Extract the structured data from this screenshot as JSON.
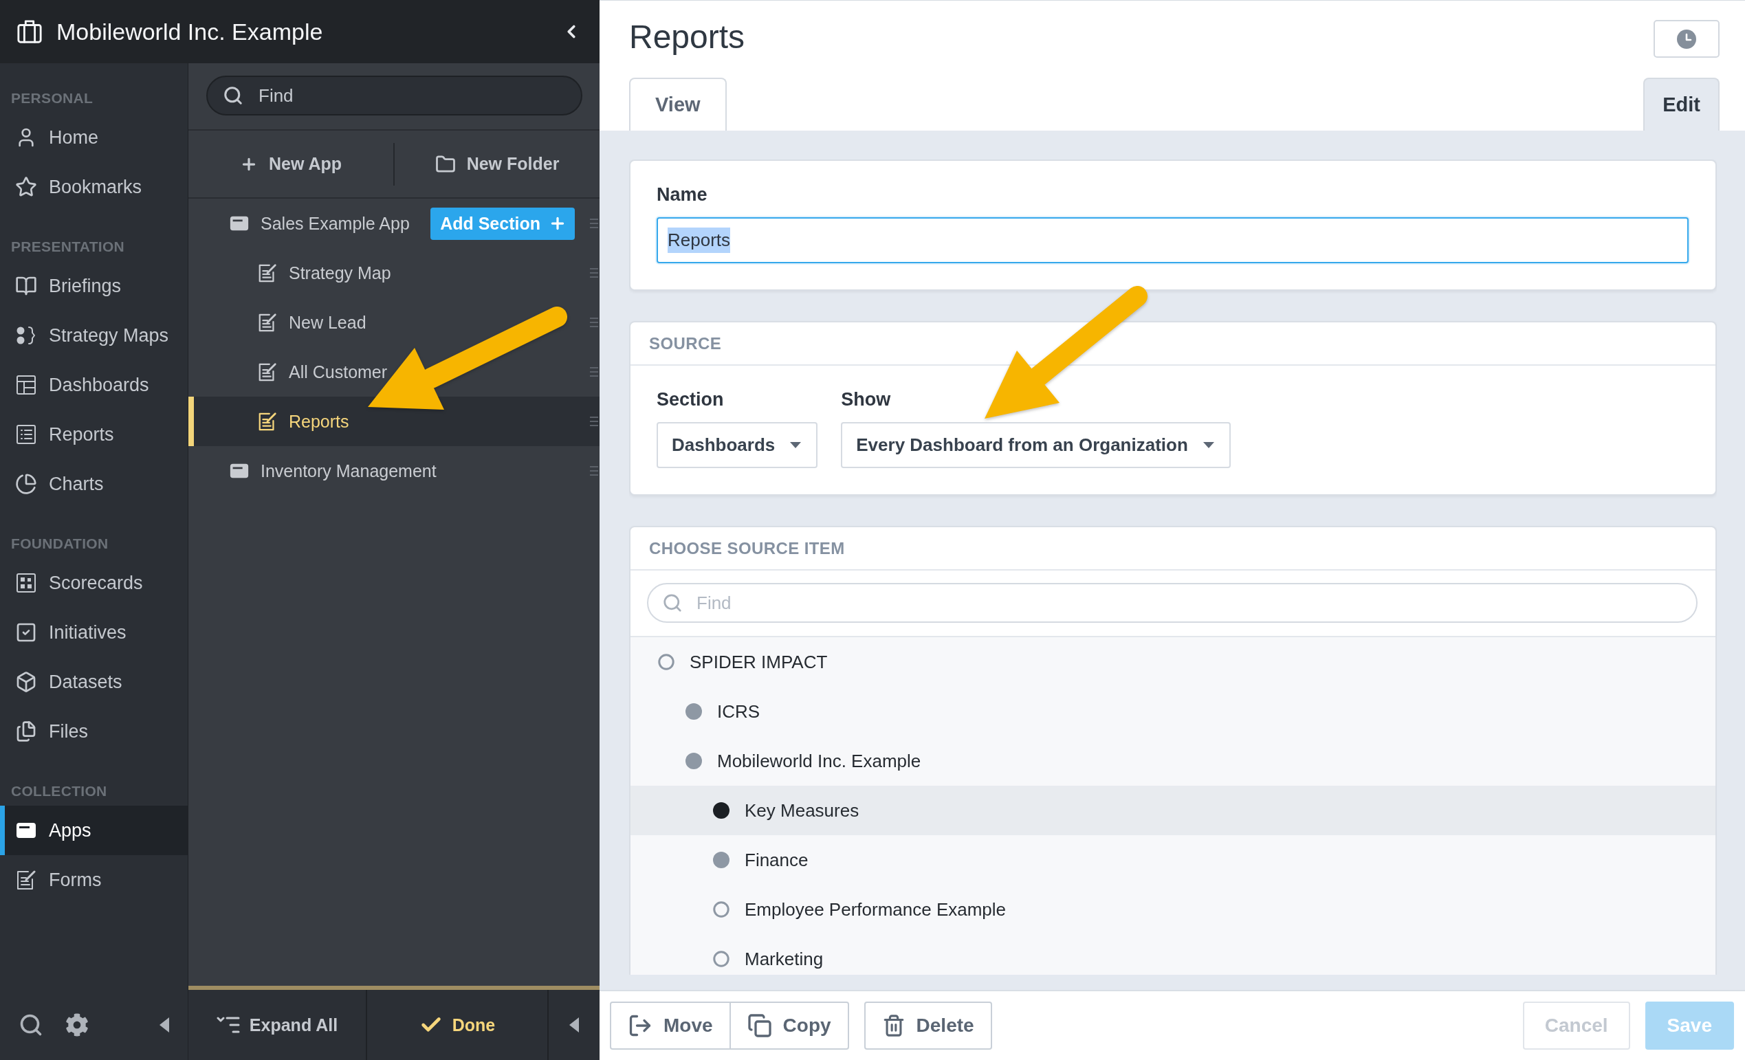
{
  "header": {
    "title": "Mobileworld Inc. Example"
  },
  "nav": [
    {
      "heading": "PERSONAL",
      "items": [
        {
          "label": "Home",
          "selected": false
        },
        {
          "label": "Bookmarks",
          "selected": false
        }
      ]
    },
    {
      "heading": "PRESENTATION",
      "items": [
        {
          "label": "Briefings",
          "selected": false
        },
        {
          "label": "Strategy Maps",
          "selected": false
        },
        {
          "label": "Dashboards",
          "selected": false
        },
        {
          "label": "Reports",
          "selected": false
        },
        {
          "label": "Charts",
          "selected": false
        }
      ]
    },
    {
      "heading": "FOUNDATION",
      "items": [
        {
          "label": "Scorecards",
          "selected": false
        },
        {
          "label": "Initiatives",
          "selected": false
        },
        {
          "label": "Datasets",
          "selected": false
        },
        {
          "label": "Files",
          "selected": false
        }
      ]
    },
    {
      "heading": "COLLECTION",
      "items": [
        {
          "label": "Apps",
          "selected": true
        },
        {
          "label": "Forms",
          "selected": false
        }
      ]
    }
  ],
  "apps_panel": {
    "search": {
      "placeholder": "Find"
    },
    "actions": [
      "New App",
      "New Folder"
    ],
    "tree": [
      {
        "label": "Sales Example App",
        "selected": false,
        "button": "Add Section",
        "children": [
          {
            "label": "Strategy Map",
            "selected": false
          },
          {
            "label": "New Lead",
            "selected": false
          },
          {
            "label": "All Customer",
            "selected": false
          },
          {
            "label": "Reports",
            "selected": true
          }
        ]
      },
      {
        "label": "Inventory Management",
        "selected": false
      }
    ],
    "footer": {
      "expand": "Expand All",
      "done": "Done"
    }
  },
  "editor": {
    "title": "Reports",
    "tabs": [
      {
        "label": "View",
        "selected": false
      },
      {
        "label": "Edit",
        "selected": true
      }
    ],
    "name_card": {
      "label": "Name",
      "value": "Reports",
      "focused": true,
      "text_selected": true
    },
    "source_card": {
      "heading": "SOURCE",
      "fields": [
        {
          "label": "Section",
          "value": "Dashboards"
        },
        {
          "label": "Show",
          "value": "Every Dashboard from an Organization"
        }
      ]
    },
    "choose_card": {
      "heading": "CHOOSE SOURCE ITEM",
      "search": {
        "placeholder": "Find"
      },
      "items": [
        {
          "label": "SPIDER IMPACT",
          "filled": false,
          "selected": false,
          "children": [
            {
              "label": "ICRS",
              "filled": true,
              "selected": false
            },
            {
              "label": "Mobileworld Inc. Example",
              "filled": true,
              "selected": false,
              "children": [
                {
                  "label": "Key Measures",
                  "filled": true,
                  "selected": true
                },
                {
                  "label": "Finance",
                  "filled": true,
                  "selected": false
                },
                {
                  "label": "Employee Performance Example",
                  "filled": false,
                  "selected": false
                },
                {
                  "label": "Marketing",
                  "filled": false,
                  "selected": false
                }
              ]
            }
          ]
        }
      ]
    },
    "footer": {
      "group": [
        {
          "label": "Move"
        },
        {
          "label": "Copy"
        }
      ],
      "delete": {
        "label": "Delete"
      },
      "cancel": {
        "label": "Cancel",
        "disabled": true
      },
      "save": {
        "label": "Save",
        "disabled": true
      }
    }
  }
}
